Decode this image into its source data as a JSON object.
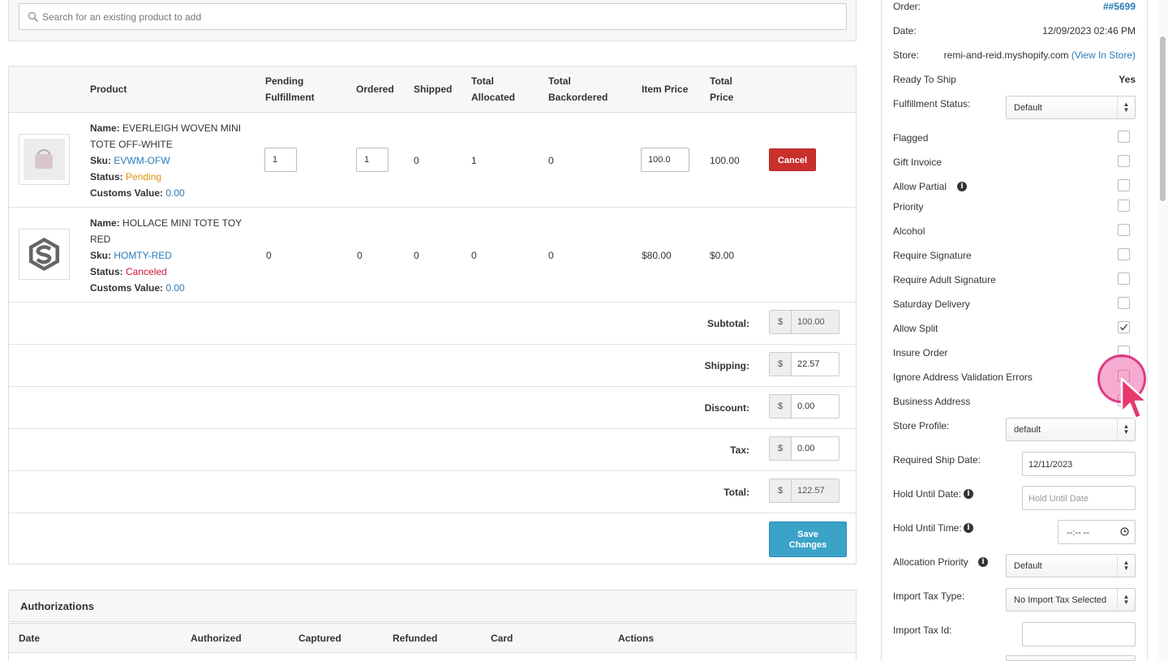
{
  "search": {
    "placeholder": "Search for an existing product to add"
  },
  "table": {
    "headers": {
      "product": "Product",
      "pending": [
        "Pending",
        "Fulfillment"
      ],
      "ordered": "Ordered",
      "shipped": "Shipped",
      "allocated": [
        "Total",
        "Allocated"
      ],
      "backordered": [
        "Total",
        "Backordered"
      ],
      "item_price": "Item Price",
      "total_price": [
        "Total",
        "Price"
      ]
    },
    "labels": {
      "name": "Name:",
      "sku": "Sku:",
      "status": "Status:",
      "customs": "Customs Value:"
    },
    "rows": [
      {
        "name_line1": "EVERLEIGH WOVEN MINI",
        "name_line2": "TOTE OFF-WHITE",
        "sku": "EVWM-OFW",
        "status": "Pending",
        "status_color": "#e0940e",
        "customs_value": "0.00",
        "pending": "1",
        "ordered": "1",
        "shipped": "0",
        "allocated": "1",
        "backordered": "0",
        "item_price": "100.0",
        "total_price": "100.00",
        "action": "Cancel"
      },
      {
        "name_line1": "HOLLACE MINI TOTE TOY",
        "name_line2": "RED",
        "sku": "HOMTY-RED",
        "status": "Canceled",
        "status_color": "#d0103a",
        "customs_value": "0.00",
        "pending": "0",
        "ordered": "0",
        "shipped": "0",
        "allocated": "0",
        "backordered": "0",
        "item_price": "$80.00",
        "total_price": "$0.00"
      }
    ],
    "totals": {
      "currency": "$",
      "subtotal_label": "Subtotal:",
      "subtotal": "100.00",
      "shipping_label": "Shipping:",
      "shipping": "22.57",
      "discount_label": "Discount:",
      "discount": "0.00",
      "tax_label": "Tax:",
      "tax": "0.00",
      "total_label": "Total:",
      "total": "122.57"
    },
    "save_label_1": "Save",
    "save_label_2": "Changes"
  },
  "authorizations": {
    "title": "Authorizations",
    "columns": [
      "Date",
      "Authorized",
      "Captured",
      "Refunded",
      "Card",
      "Actions"
    ]
  },
  "order": {
    "order_label": "Order:",
    "order_value": "##5699",
    "date_label": "Date:",
    "date_value": "12/09/2023 02:46 PM",
    "store_label": "Store:",
    "store_value": "remi-and-reid.myshopify.com",
    "store_link": "(View In Store)",
    "ready_label": "Ready To Ship",
    "ready_value": "Yes",
    "fulfillment_label": "Fulfillment Status:",
    "fulfillment_value": "Default",
    "flags": [
      {
        "label": "Flagged",
        "checked": false
      },
      {
        "label": "Gift Invoice",
        "checked": false
      },
      {
        "label": "Allow Partial",
        "checked": false,
        "info": true
      },
      {
        "label": "Priority",
        "checked": false
      },
      {
        "label": "Alcohol",
        "checked": false
      },
      {
        "label": "Require Signature",
        "checked": false
      },
      {
        "label": "Require Adult Signature",
        "checked": false
      },
      {
        "label": "Saturday Delivery",
        "checked": false
      },
      {
        "label": "Allow Split",
        "checked": true
      },
      {
        "label": "Insure Order",
        "checked": false
      },
      {
        "label": "Ignore Address Validation Errors",
        "checked": false
      },
      {
        "label": "Business Address",
        "checked": false
      }
    ],
    "store_profile_label": "Store Profile:",
    "store_profile_value": "default",
    "ship_date_label": "Required Ship Date:",
    "ship_date_value": "12/11/2023",
    "hold_date_label": "Hold Until Date:",
    "hold_date_placeholder": "Hold Until Date",
    "hold_time_label": "Hold Until Time:",
    "hold_time_value": "--:-- --",
    "alloc_label": "Allocation Priority",
    "alloc_value": "Default",
    "import_tax_type_label": "Import Tax Type:",
    "import_tax_type_value": "No Import Tax Selected",
    "import_tax_id_label": "Import Tax Id:"
  },
  "colors": {
    "link": "#2a7ab8",
    "cancel": "#c9302c",
    "save": "#3ba3c8",
    "cursor": "#db2777"
  }
}
